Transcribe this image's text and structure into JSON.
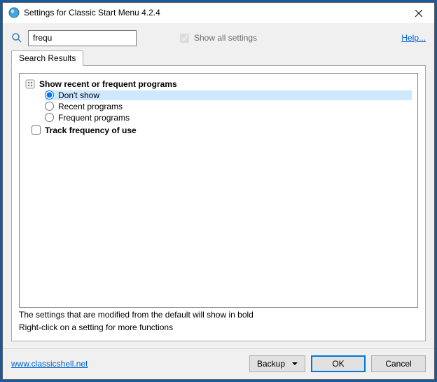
{
  "window": {
    "title": "Settings for Classic Start Menu 4.2.4"
  },
  "search": {
    "value": "frequ",
    "show_all_label": "Show all settings",
    "show_all_checked": true,
    "help_label": "Help..."
  },
  "tab": {
    "label": "Search Results"
  },
  "results": {
    "group1": {
      "label": "Show recent or frequent programs",
      "options": [
        {
          "label": "Don't show",
          "selected": true
        },
        {
          "label": "Recent programs",
          "selected": false
        },
        {
          "label": "Frequent programs",
          "selected": false
        }
      ]
    },
    "check1": {
      "label": "Track frequency of use",
      "checked": false
    }
  },
  "hints": {
    "line1": "The settings that are modified from the default will show in bold",
    "line2": "Right-click on a setting for more functions"
  },
  "footer": {
    "site_link": "www.classicshell.net",
    "backup": "Backup",
    "ok": "OK",
    "cancel": "Cancel"
  }
}
